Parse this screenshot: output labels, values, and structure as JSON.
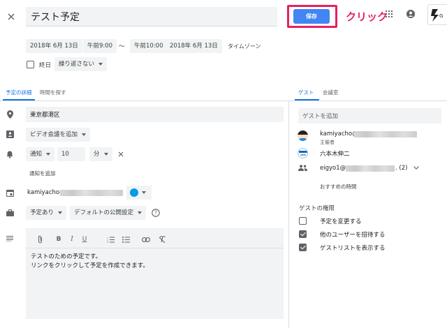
{
  "header": {
    "title": "テスト予定",
    "save_label": "保存",
    "annotation": "クリック"
  },
  "datetime": {
    "start_date": "2018年 6月 13日",
    "start_time": "午前9:00",
    "separator": "〜",
    "end_time": "午前10:00",
    "end_date": "2018年 6月 13日",
    "timezone_label": "タイムゾーン",
    "allday_label": "終日",
    "repeat_label": "繰り返さない"
  },
  "tabs": {
    "details": "予定の詳細",
    "find_time": "時間を探す",
    "guests": "ゲスト",
    "rooms": "会議室"
  },
  "details": {
    "location": "東京都港区",
    "video_label": "ビデオ会議を追加",
    "notify_type": "通知",
    "notify_value": "10",
    "notify_unit": "分",
    "add_notification": "通知を追加",
    "calendar_owner": "kamiyacho@",
    "availability": "予定あり",
    "visibility": "デフォルトの公開設定",
    "description_line1": "テストのための予定です。",
    "description_line2": "リンクをクリックして予定を作成できます。"
  },
  "guests": {
    "add_placeholder": "ゲストを追加",
    "list": [
      {
        "name": "kamiyacho@",
        "sub": "主催者"
      },
      {
        "name": "六本木伸二",
        "sub": ""
      },
      {
        "name": "eigyo1@",
        "sub": "",
        "suffix": ". (2)"
      }
    ],
    "suggested_times": "おすすめの時間",
    "permissions_title": "ゲストの権限",
    "permissions": [
      {
        "label": "予定を変更する",
        "checked": false
      },
      {
        "label": "他のユーザーを招待する",
        "checked": true
      },
      {
        "label": "ゲストリストを表示する",
        "checked": true
      }
    ]
  },
  "colors": {
    "accent": "#1a73e8",
    "save_button": "#4285f4",
    "highlight": "#e91e63",
    "calendar_color": "#039be5"
  }
}
